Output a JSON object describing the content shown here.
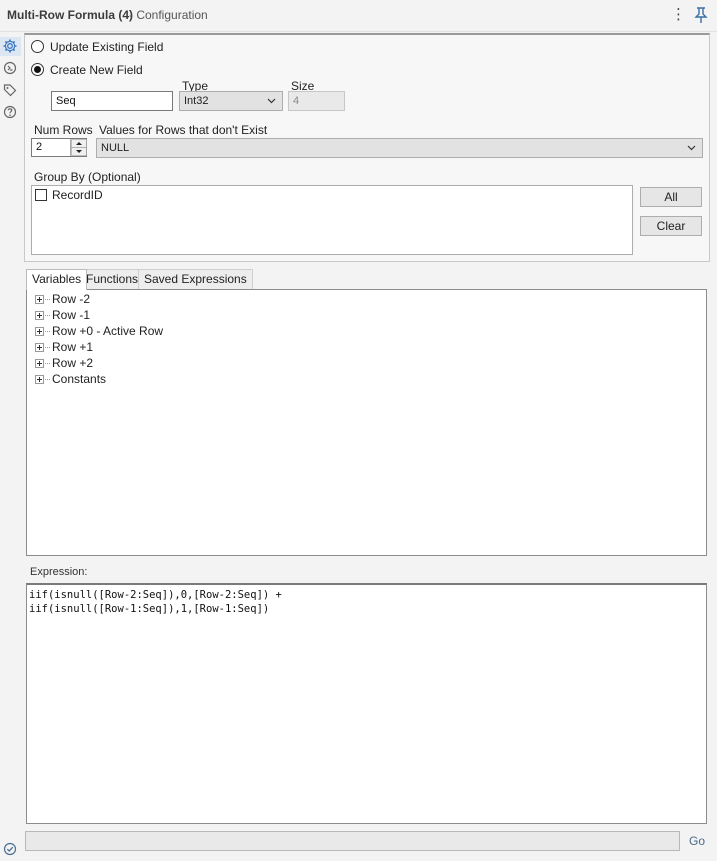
{
  "window": {
    "title": "Multi-Row Formula (4)",
    "subtitle": "- Configuration",
    "menu_icon": "kebab-menu-icon",
    "pin_icon": "pin-icon"
  },
  "rail": {
    "items": [
      {
        "name": "configuration",
        "icon": "gear-icon",
        "active": true
      },
      {
        "name": "annotation",
        "icon": "annotation-icon",
        "active": false
      },
      {
        "name": "tags",
        "icon": "tag-icon",
        "active": false
      },
      {
        "name": "help",
        "icon": "help-icon",
        "active": false
      }
    ],
    "bottom_icon": "check-circle-icon"
  },
  "config": {
    "update_existing_label": "Update Existing Field",
    "create_new_label": "Create New  Field",
    "selected_mode": "create_new",
    "field_name_value": "Seq",
    "type_label": "Type",
    "type_value": "Int32",
    "size_label": "Size",
    "size_value": "4",
    "num_rows_label": "Num Rows",
    "num_rows_value": "2",
    "values_nonexist_label": "Values for Rows that don't Exist",
    "values_nonexist_value": "NULL",
    "group_by_label": "Group By (Optional)",
    "group_by_items": [
      {
        "label": "RecordID",
        "checked": false
      }
    ],
    "all_button": "All",
    "clear_button": "Clear"
  },
  "tabs": [
    {
      "label": "Variables",
      "active": true
    },
    {
      "label": "Functions",
      "active": false
    },
    {
      "label": "Saved Expressions",
      "active": false
    }
  ],
  "tree": {
    "items": [
      {
        "label": "Row -2"
      },
      {
        "label": "Row -1"
      },
      {
        "label": "Row +0 - Active Row"
      },
      {
        "label": "Row +1"
      },
      {
        "label": "Row +2"
      },
      {
        "label": "Constants"
      }
    ]
  },
  "expression": {
    "label": "Expression:",
    "lines": [
      "iif(isnull([Row-2:Seq]),0,[Row-2:Seq]) +",
      "iif(isnull([Row-1:Seq]),1,[Row-1:Seq])"
    ]
  },
  "bottom": {
    "go_label": "Go"
  },
  "colors": {
    "accent": "#3b78c3",
    "background": "#f3f3f3"
  }
}
